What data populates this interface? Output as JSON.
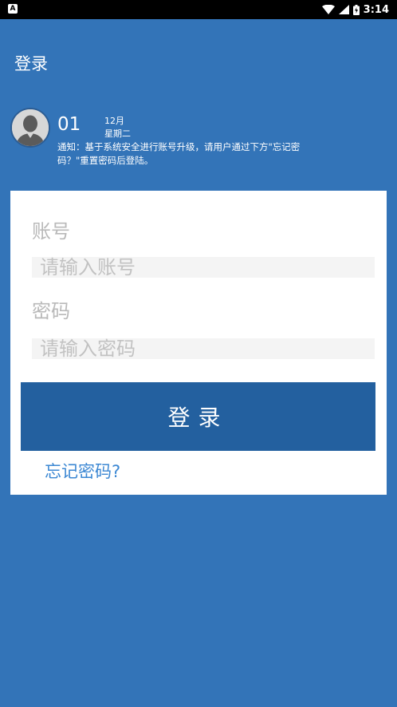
{
  "status_bar": {
    "time": "3:14"
  },
  "page": {
    "title": "登录"
  },
  "notice": {
    "day": "01",
    "month": "12月",
    "weekday": "星期二",
    "text": "通知：基于系统安全进行账号升级，请用户通过下方\"忘记密码？\"重置密码后登陆。"
  },
  "form": {
    "account_label": "账号",
    "account_placeholder": "请输入账号",
    "password_label": "密码",
    "password_placeholder": "请输入密码",
    "login_button": "登录",
    "forgot_link": "忘记密码?"
  },
  "colors": {
    "background": "#3374b8",
    "button": "#23609f",
    "link": "#3b87d3"
  }
}
